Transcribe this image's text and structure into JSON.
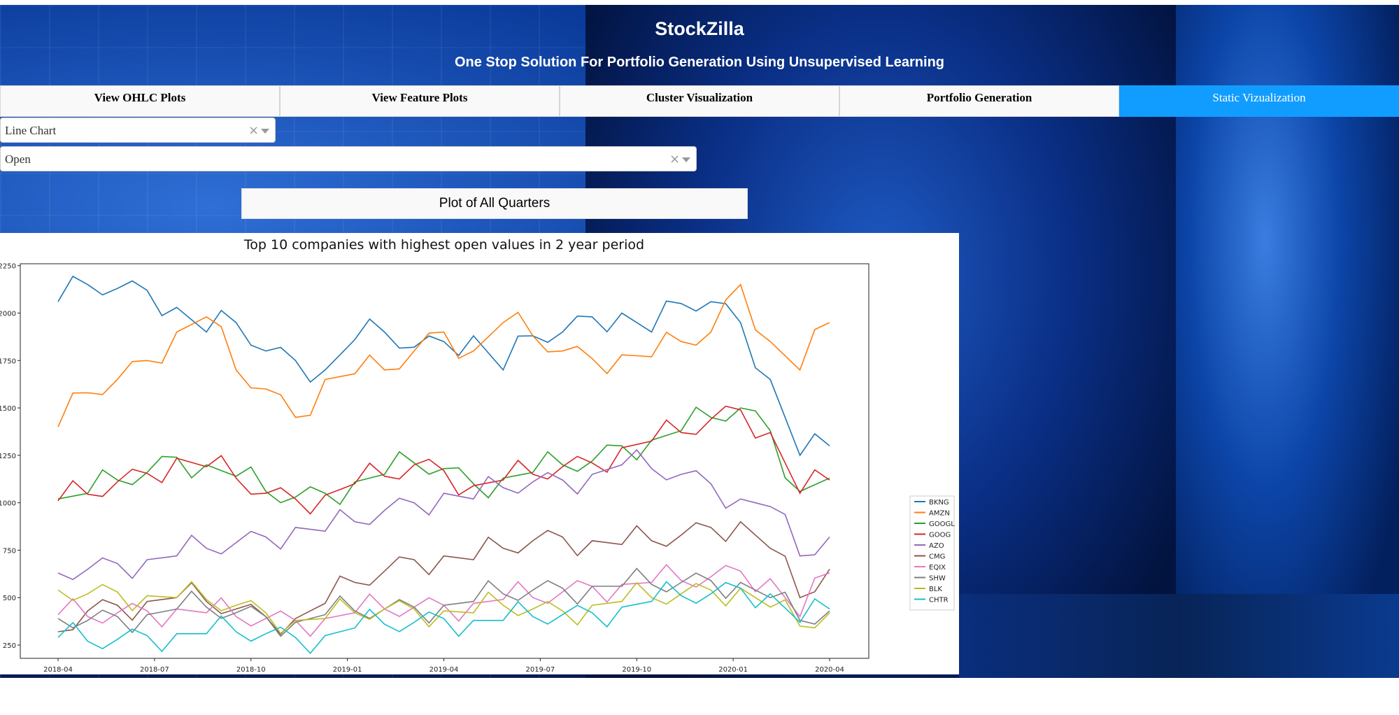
{
  "header": {
    "title": "StockZilla",
    "subtitle": "One Stop Solution For Portfolio Generation Using Unsupervised Learning"
  },
  "tabs": [
    {
      "label": "View OHLC Plots",
      "active": false
    },
    {
      "label": "View Feature Plots",
      "active": false
    },
    {
      "label": "Cluster Visualization",
      "active": false
    },
    {
      "label": "Portfolio Generation",
      "active": false
    },
    {
      "label": "Static Vizualization",
      "active": true
    }
  ],
  "controls": {
    "chart_type_select": {
      "value": "Line Chart"
    },
    "feature_select": {
      "value": "Open"
    },
    "clear_glyph": "×",
    "plot_button_label": "Plot of All Quarters"
  },
  "colors": {
    "active_tab": "#119dff"
  },
  "chart_data": {
    "type": "line",
    "title": "Top 10 companies with highest open values in 2 year period",
    "xlabel": "",
    "ylabel": "",
    "x_ticks": [
      "2018-04",
      "2018-07",
      "2018-10",
      "2019-01",
      "2019-04",
      "2019-07",
      "2019-10",
      "2020-01",
      "2020-04"
    ],
    "y_ticks": [
      250,
      500,
      750,
      1000,
      1250,
      1500,
      1750,
      2000,
      2250
    ],
    "ylim": [
      180,
      2260
    ],
    "legend_position": "right",
    "x": [
      "2018-04",
      "2018-05",
      "2018-06",
      "2018-07",
      "2018-08",
      "2018-09",
      "2018-10",
      "2018-11",
      "2018-12",
      "2019-01",
      "2019-02",
      "2019-03",
      "2019-04",
      "2019-05",
      "2019-06",
      "2019-07",
      "2019-08",
      "2019-09",
      "2019-10",
      "2019-11",
      "2019-12",
      "2020-01",
      "2020-02",
      "2020-02-20",
      "2020-03",
      "2020-03-15",
      "2020-04"
    ],
    "series": [
      {
        "name": "BKNG",
        "color": "#1f77b4",
        "values": [
          2060,
          2150,
          2130,
          2120,
          2030,
          1900,
          1950,
          1800,
          1750,
          1700,
          1860,
          1900,
          1820,
          1850,
          1880,
          1700,
          1880,
          1900,
          1980,
          2000,
          1900,
          2050,
          2060,
          1950,
          1650,
          1250,
          1300
        ]
      },
      {
        "name": "AMZN",
        "color": "#ff7f0e",
        "values": [
          1400,
          1580,
          1650,
          1750,
          1900,
          1980,
          1700,
          1600,
          1450,
          1650,
          1680,
          1700,
          1800,
          1900,
          1800,
          1950,
          1880,
          1800,
          1760,
          1780,
          1770,
          1850,
          1900,
          2150,
          1850,
          1700,
          1950
        ]
      },
      {
        "name": "GOOGL",
        "color": "#2ca02c",
        "values": [
          1020,
          1050,
          1120,
          1160,
          1240,
          1200,
          1140,
          1060,
          1030,
          1050,
          1110,
          1150,
          1210,
          1180,
          1100,
          1130,
          1160,
          1200,
          1220,
          1300,
          1330,
          1380,
          1450,
          1500,
          1380,
          1060,
          1130
        ]
      },
      {
        "name": "GOOG",
        "color": "#d62728",
        "values": [
          1010,
          1045,
          1110,
          1155,
          1235,
          1190,
          1130,
          1050,
          1020,
          1040,
          1100,
          1140,
          1200,
          1170,
          1090,
          1120,
          1150,
          1190,
          1210,
          1290,
          1325,
          1370,
          1440,
          1490,
          1370,
          1050,
          1120
        ]
      },
      {
        "name": "AZO",
        "color": "#9467bd",
        "values": [
          630,
          650,
          680,
          700,
          720,
          760,
          790,
          820,
          870,
          850,
          900,
          960,
          1000,
          1050,
          1020,
          1080,
          1110,
          1120,
          1150,
          1200,
          1180,
          1150,
          1100,
          1020,
          980,
          720,
          820
        ]
      },
      {
        "name": "CMG",
        "color": "#8c564b",
        "values": [
          320,
          430,
          460,
          480,
          500,
          480,
          440,
          400,
          390,
          470,
          580,
          640,
          700,
          720,
          700,
          760,
          800,
          820,
          800,
          780,
          800,
          830,
          870,
          900,
          760,
          500,
          650
        ]
      },
      {
        "name": "EQIX",
        "color": "#e377c2",
        "values": [
          410,
          400,
          420,
          430,
          440,
          420,
          400,
          390,
          380,
          390,
          420,
          440,
          450,
          460,
          470,
          490,
          500,
          530,
          560,
          570,
          580,
          590,
          610,
          640,
          600,
          400,
          630
        ]
      },
      {
        "name": "SHW",
        "color": "#7f7f7f",
        "values": [
          390,
          380,
          400,
          410,
          440,
          450,
          420,
          400,
          370,
          410,
          430,
          440,
          450,
          460,
          480,
          520,
          540,
          550,
          560,
          560,
          570,
          580,
          590,
          580,
          500,
          380,
          430
        ]
      },
      {
        "name": "BLK",
        "color": "#bcbd22",
        "values": [
          540,
          520,
          530,
          510,
          500,
          490,
          460,
          420,
          380,
          390,
          420,
          440,
          440,
          430,
          420,
          460,
          440,
          430,
          460,
          480,
          500,
          520,
          540,
          550,
          450,
          350,
          420
        ]
      },
      {
        "name": "CHTR",
        "color": "#17becf",
        "values": [
          290,
          270,
          280,
          300,
          310,
          310,
          320,
          310,
          290,
          300,
          340,
          360,
          370,
          390,
          380,
          380,
          400,
          410,
          420,
          450,
          480,
          510,
          520,
          550,
          520,
          370,
          440
        ]
      }
    ]
  }
}
